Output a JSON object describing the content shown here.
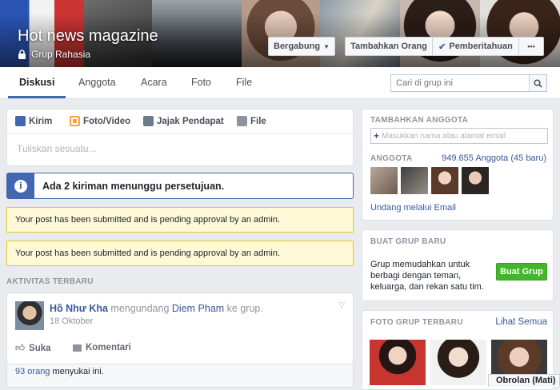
{
  "group": {
    "title": "Hot news magazine",
    "privacy": "Grup Rahasia"
  },
  "cover_buttons": {
    "join": "Bergabung",
    "add_people": "Tambahkan Orang",
    "notifications": "Pemberitahuan",
    "more": "•••"
  },
  "tabs": [
    "Diskusi",
    "Anggota",
    "Acara",
    "Foto",
    "File"
  ],
  "search": {
    "placeholder": "Cari di grup ini"
  },
  "composer": {
    "tabs": [
      "Kirim",
      "Foto/Video",
      "Jajak Pendapat",
      "File"
    ],
    "placeholder": "Tuliskan sesuatu..."
  },
  "pending_info": "Ada 2 kiriman menunggu persetujuan.",
  "notices": [
    "Your post has been submitted and is pending approval by an admin.",
    "Your post has been submitted and is pending approval by an admin."
  ],
  "recent": {
    "header": "AKTIVITAS TERBARU",
    "post": {
      "author": "Hồ Như Kha",
      "action": "mengundang",
      "target": "Diem Pham",
      "suffix": "ke grup.",
      "date": "18 Oktober",
      "like_label": "Suka",
      "comment_label": "Komentari",
      "likes_count": "93 orang",
      "likes_suffix": "menyukai ini."
    }
  },
  "sidebar": {
    "add_member_header": "TAMBAHKAN ANGGOTA",
    "add_member_placeholder": "Masukkan nama atau alamat email",
    "members_header": "ANGGOTA",
    "members_count": "949.655 Anggota (45 baru)",
    "invite_email": "Undang melalui Email",
    "create_group_header": "BUAT GRUP BARU",
    "create_group_text": "Grup memudahkan untuk berbagi dengan teman, keluarga, dan rekan satu tim.",
    "create_group_button": "Buat Grup",
    "recent_photos_header": "FOTO GRUP TERBARU",
    "see_all": "Lihat Semua",
    "chat_tab": "Obrolan (Mati)"
  },
  "colors": {
    "brand_blue": "#4267b2",
    "link": "#365899",
    "green_button": "#42b72a",
    "notice_bg": "#fff9d7",
    "notice_border": "#e2c822"
  }
}
